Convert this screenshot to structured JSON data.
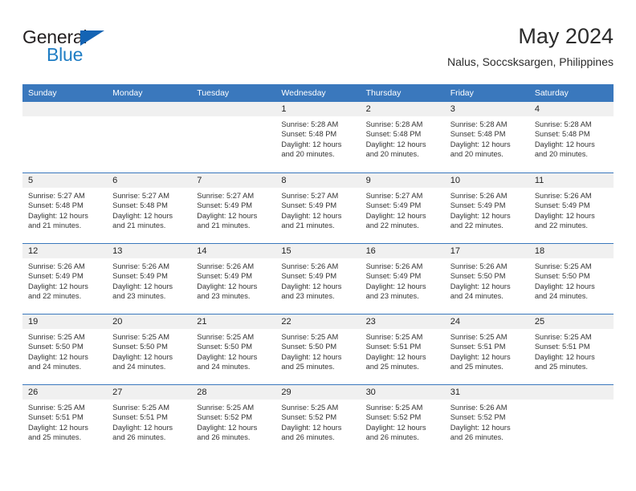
{
  "brand": {
    "name_part1": "General",
    "name_part2": "Blue",
    "color_dark": "#231f20",
    "color_blue": "#1f7dc4"
  },
  "header": {
    "title": "May 2024",
    "subtitle": "Nalus, Soccsksargen, Philippines"
  },
  "theme": {
    "header_bg": "#3a78bd",
    "daynum_band_bg": "#f0f0f0",
    "text": "#333333"
  },
  "weekday_headers": [
    "Sunday",
    "Monday",
    "Tuesday",
    "Wednesday",
    "Thursday",
    "Friday",
    "Saturday"
  ],
  "weeks": [
    [
      {
        "day": "",
        "sunrise": "",
        "sunset": "",
        "daylight_1": "",
        "daylight_2": "",
        "empty": true
      },
      {
        "day": "",
        "sunrise": "",
        "sunset": "",
        "daylight_1": "",
        "daylight_2": "",
        "empty": true
      },
      {
        "day": "",
        "sunrise": "",
        "sunset": "",
        "daylight_1": "",
        "daylight_2": "",
        "empty": true
      },
      {
        "day": "1",
        "sunrise": "Sunrise: 5:28 AM",
        "sunset": "Sunset: 5:48 PM",
        "daylight_1": "Daylight: 12 hours",
        "daylight_2": "and 20 minutes.",
        "empty": false
      },
      {
        "day": "2",
        "sunrise": "Sunrise: 5:28 AM",
        "sunset": "Sunset: 5:48 PM",
        "daylight_1": "Daylight: 12 hours",
        "daylight_2": "and 20 minutes.",
        "empty": false
      },
      {
        "day": "3",
        "sunrise": "Sunrise: 5:28 AM",
        "sunset": "Sunset: 5:48 PM",
        "daylight_1": "Daylight: 12 hours",
        "daylight_2": "and 20 minutes.",
        "empty": false
      },
      {
        "day": "4",
        "sunrise": "Sunrise: 5:28 AM",
        "sunset": "Sunset: 5:48 PM",
        "daylight_1": "Daylight: 12 hours",
        "daylight_2": "and 20 minutes.",
        "empty": false
      }
    ],
    [
      {
        "day": "5",
        "sunrise": "Sunrise: 5:27 AM",
        "sunset": "Sunset: 5:48 PM",
        "daylight_1": "Daylight: 12 hours",
        "daylight_2": "and 21 minutes.",
        "empty": false
      },
      {
        "day": "6",
        "sunrise": "Sunrise: 5:27 AM",
        "sunset": "Sunset: 5:48 PM",
        "daylight_1": "Daylight: 12 hours",
        "daylight_2": "and 21 minutes.",
        "empty": false
      },
      {
        "day": "7",
        "sunrise": "Sunrise: 5:27 AM",
        "sunset": "Sunset: 5:49 PM",
        "daylight_1": "Daylight: 12 hours",
        "daylight_2": "and 21 minutes.",
        "empty": false
      },
      {
        "day": "8",
        "sunrise": "Sunrise: 5:27 AM",
        "sunset": "Sunset: 5:49 PM",
        "daylight_1": "Daylight: 12 hours",
        "daylight_2": "and 21 minutes.",
        "empty": false
      },
      {
        "day": "9",
        "sunrise": "Sunrise: 5:27 AM",
        "sunset": "Sunset: 5:49 PM",
        "daylight_1": "Daylight: 12 hours",
        "daylight_2": "and 22 minutes.",
        "empty": false
      },
      {
        "day": "10",
        "sunrise": "Sunrise: 5:26 AM",
        "sunset": "Sunset: 5:49 PM",
        "daylight_1": "Daylight: 12 hours",
        "daylight_2": "and 22 minutes.",
        "empty": false
      },
      {
        "day": "11",
        "sunrise": "Sunrise: 5:26 AM",
        "sunset": "Sunset: 5:49 PM",
        "daylight_1": "Daylight: 12 hours",
        "daylight_2": "and 22 minutes.",
        "empty": false
      }
    ],
    [
      {
        "day": "12",
        "sunrise": "Sunrise: 5:26 AM",
        "sunset": "Sunset: 5:49 PM",
        "daylight_1": "Daylight: 12 hours",
        "daylight_2": "and 22 minutes.",
        "empty": false
      },
      {
        "day": "13",
        "sunrise": "Sunrise: 5:26 AM",
        "sunset": "Sunset: 5:49 PM",
        "daylight_1": "Daylight: 12 hours",
        "daylight_2": "and 23 minutes.",
        "empty": false
      },
      {
        "day": "14",
        "sunrise": "Sunrise: 5:26 AM",
        "sunset": "Sunset: 5:49 PM",
        "daylight_1": "Daylight: 12 hours",
        "daylight_2": "and 23 minutes.",
        "empty": false
      },
      {
        "day": "15",
        "sunrise": "Sunrise: 5:26 AM",
        "sunset": "Sunset: 5:49 PM",
        "daylight_1": "Daylight: 12 hours",
        "daylight_2": "and 23 minutes.",
        "empty": false
      },
      {
        "day": "16",
        "sunrise": "Sunrise: 5:26 AM",
        "sunset": "Sunset: 5:49 PM",
        "daylight_1": "Daylight: 12 hours",
        "daylight_2": "and 23 minutes.",
        "empty": false
      },
      {
        "day": "17",
        "sunrise": "Sunrise: 5:26 AM",
        "sunset": "Sunset: 5:50 PM",
        "daylight_1": "Daylight: 12 hours",
        "daylight_2": "and 24 minutes.",
        "empty": false
      },
      {
        "day": "18",
        "sunrise": "Sunrise: 5:25 AM",
        "sunset": "Sunset: 5:50 PM",
        "daylight_1": "Daylight: 12 hours",
        "daylight_2": "and 24 minutes.",
        "empty": false
      }
    ],
    [
      {
        "day": "19",
        "sunrise": "Sunrise: 5:25 AM",
        "sunset": "Sunset: 5:50 PM",
        "daylight_1": "Daylight: 12 hours",
        "daylight_2": "and 24 minutes.",
        "empty": false
      },
      {
        "day": "20",
        "sunrise": "Sunrise: 5:25 AM",
        "sunset": "Sunset: 5:50 PM",
        "daylight_1": "Daylight: 12 hours",
        "daylight_2": "and 24 minutes.",
        "empty": false
      },
      {
        "day": "21",
        "sunrise": "Sunrise: 5:25 AM",
        "sunset": "Sunset: 5:50 PM",
        "daylight_1": "Daylight: 12 hours",
        "daylight_2": "and 24 minutes.",
        "empty": false
      },
      {
        "day": "22",
        "sunrise": "Sunrise: 5:25 AM",
        "sunset": "Sunset: 5:50 PM",
        "daylight_1": "Daylight: 12 hours",
        "daylight_2": "and 25 minutes.",
        "empty": false
      },
      {
        "day": "23",
        "sunrise": "Sunrise: 5:25 AM",
        "sunset": "Sunset: 5:51 PM",
        "daylight_1": "Daylight: 12 hours",
        "daylight_2": "and 25 minutes.",
        "empty": false
      },
      {
        "day": "24",
        "sunrise": "Sunrise: 5:25 AM",
        "sunset": "Sunset: 5:51 PM",
        "daylight_1": "Daylight: 12 hours",
        "daylight_2": "and 25 minutes.",
        "empty": false
      },
      {
        "day": "25",
        "sunrise": "Sunrise: 5:25 AM",
        "sunset": "Sunset: 5:51 PM",
        "daylight_1": "Daylight: 12 hours",
        "daylight_2": "and 25 minutes.",
        "empty": false
      }
    ],
    [
      {
        "day": "26",
        "sunrise": "Sunrise: 5:25 AM",
        "sunset": "Sunset: 5:51 PM",
        "daylight_1": "Daylight: 12 hours",
        "daylight_2": "and 25 minutes.",
        "empty": false
      },
      {
        "day": "27",
        "sunrise": "Sunrise: 5:25 AM",
        "sunset": "Sunset: 5:51 PM",
        "daylight_1": "Daylight: 12 hours",
        "daylight_2": "and 26 minutes.",
        "empty": false
      },
      {
        "day": "28",
        "sunrise": "Sunrise: 5:25 AM",
        "sunset": "Sunset: 5:52 PM",
        "daylight_1": "Daylight: 12 hours",
        "daylight_2": "and 26 minutes.",
        "empty": false
      },
      {
        "day": "29",
        "sunrise": "Sunrise: 5:25 AM",
        "sunset": "Sunset: 5:52 PM",
        "daylight_1": "Daylight: 12 hours",
        "daylight_2": "and 26 minutes.",
        "empty": false
      },
      {
        "day": "30",
        "sunrise": "Sunrise: 5:25 AM",
        "sunset": "Sunset: 5:52 PM",
        "daylight_1": "Daylight: 12 hours",
        "daylight_2": "and 26 minutes.",
        "empty": false
      },
      {
        "day": "31",
        "sunrise": "Sunrise: 5:26 AM",
        "sunset": "Sunset: 5:52 PM",
        "daylight_1": "Daylight: 12 hours",
        "daylight_2": "and 26 minutes.",
        "empty": false
      },
      {
        "day": "",
        "sunrise": "",
        "sunset": "",
        "daylight_1": "",
        "daylight_2": "",
        "empty": true
      }
    ]
  ]
}
